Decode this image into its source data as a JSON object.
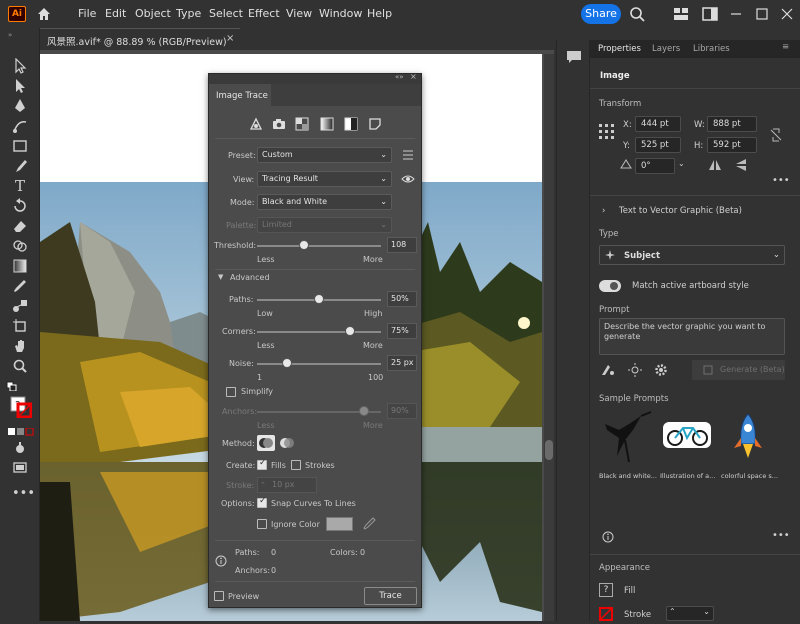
{
  "app": {
    "logo": "Ai"
  },
  "menu": [
    "File",
    "Edit",
    "Object",
    "Type",
    "Select",
    "Effect",
    "View",
    "Window",
    "Help"
  ],
  "share_label": "Share",
  "doc_tab": {
    "title": "风景照.avif* @ 88.89 % (RGB/Preview)",
    "close": "×"
  },
  "right_tabs": {
    "properties": "Properties",
    "layers": "Layers",
    "libraries": "Libraries"
  },
  "properties": {
    "section": "Image",
    "transform": "Transform",
    "x_label": "X:",
    "x": "444 pt",
    "y_label": "Y:",
    "y": "525 pt",
    "w_label": "W:",
    "w": "888 pt",
    "h_label": "H:",
    "h": "592 pt",
    "angle": "0°",
    "ttv_title": "Text to Vector Graphic (Beta)",
    "type_label": "Type",
    "type_value": "Subject",
    "match_label": "Match active artboard style",
    "prompt_label": "Prompt",
    "prompt_placeholder": "Describe the vector graphic you want to generate",
    "generate_label": "Generate (Beta)",
    "sample_prompts": "Sample Prompts",
    "samples": [
      "Black and white...",
      "Illustration of a...",
      "colorful space s..."
    ],
    "appearance": "Appearance",
    "fill": "Fill",
    "stroke": "Stroke"
  },
  "trace": {
    "title": "Image Trace",
    "preset_label": "Preset:",
    "preset": "Custom",
    "view_label": "View:",
    "view": "Tracing Result",
    "mode_label": "Mode:",
    "mode": "Black and White",
    "palette_label": "Palette:",
    "palette": "Limited",
    "threshold_label": "Threshold:",
    "threshold": "108",
    "threshold_fraction": 0.38,
    "less": "Less",
    "more": "More",
    "advanced": "Advanced",
    "paths_label": "Paths:",
    "paths": "50%",
    "paths_fraction": 0.5,
    "low": "Low",
    "high": "High",
    "corners_label": "Corners:",
    "corners": "75%",
    "corners_fraction": 0.75,
    "noise_label": "Noise:",
    "noise": "25 px",
    "noise_fraction": 0.24,
    "noise_min": "1",
    "noise_max": "100",
    "simplify": "Simplify",
    "anchors_label": "Anchors:",
    "anchors": "90%",
    "method_label": "Method:",
    "create_label": "Create:",
    "fills": "Fills",
    "strokes": "Strokes",
    "stroke_label": "Stroke:",
    "stroke_value": "10 px",
    "options_label": "Options:",
    "snap": "Snap Curves To Lines",
    "ignore_color": "Ignore Color",
    "info_paths_label": "Paths:",
    "info_paths": "0",
    "info_colors_label": "Colors:",
    "info_colors": "0",
    "info_anchors_label": "Anchors:",
    "info_anchors": "0",
    "preview": "Preview",
    "trace_btn": "Trace"
  },
  "colors": {
    "accent": "#1473e6",
    "bg": "#323232",
    "dialog": "#4b4b4b"
  }
}
